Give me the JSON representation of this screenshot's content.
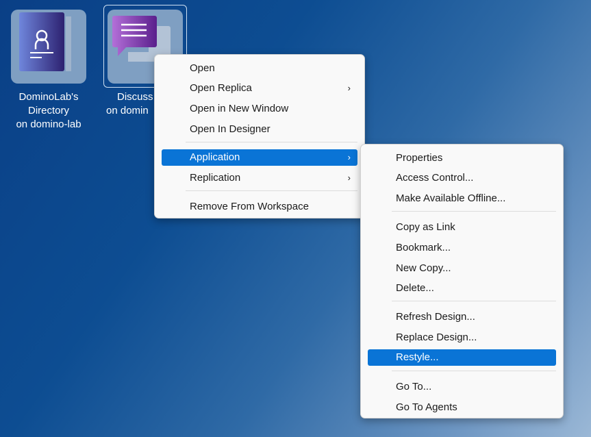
{
  "desktop": {
    "icons": [
      {
        "label_lines": [
          "DominoLab's",
          "Directory",
          "on domino-lab"
        ]
      },
      {
        "label_lines": [
          "Discuss",
          "on domin"
        ]
      }
    ]
  },
  "context_menu": {
    "items": [
      {
        "label": "Open"
      },
      {
        "label": "Open Replica",
        "submenu": true
      },
      {
        "label": "Open in New Window"
      },
      {
        "label": "Open In Designer"
      },
      {
        "label": "Application",
        "submenu": true,
        "highlighted": true
      },
      {
        "label": "Replication",
        "submenu": true
      },
      {
        "label": "Remove From Workspace"
      }
    ]
  },
  "submenu": {
    "items": [
      {
        "label": "Properties"
      },
      {
        "label": "Access Control..."
      },
      {
        "label": "Make Available Offline..."
      },
      {
        "label": "Copy as Link"
      },
      {
        "label": "Bookmark..."
      },
      {
        "label": "New Copy..."
      },
      {
        "label": "Delete..."
      },
      {
        "label": "Refresh Design..."
      },
      {
        "label": "Replace Design..."
      },
      {
        "label": "Restyle...",
        "highlighted": true
      },
      {
        "label": "Go To..."
      },
      {
        "label": "Go To Agents"
      }
    ]
  },
  "colors": {
    "highlight": "#0a74d6"
  },
  "chevron": "›"
}
